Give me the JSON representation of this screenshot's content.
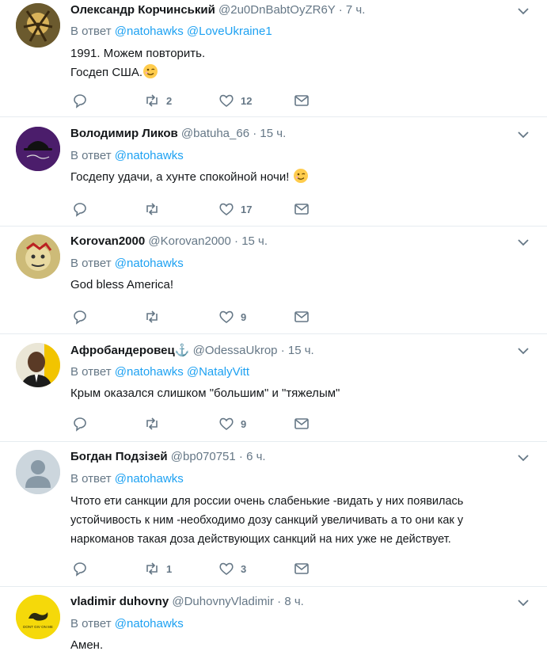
{
  "ui": {
    "reply_prefix": "В ответ",
    "accent": "#1da1f2",
    "muted": "#657786"
  },
  "tweets": [
    {
      "name": "Олександр Корчинський",
      "handle": "@2u0DnBabtOyZR6Y",
      "time": "7 ч.",
      "mentions": [
        "@natohawks",
        "@LoveUkraine1"
      ],
      "lines": [
        "1991. Можем повторить.",
        "Госдеп США."
      ],
      "emoji": "winking-face",
      "counts": {
        "retweets": "2",
        "likes": "12"
      }
    },
    {
      "name": "Володимир Ликов",
      "handle": "@batuha_66",
      "time": "15 ч.",
      "mentions": [
        "@natohawks"
      ],
      "lines": [
        "Госдепу удачи, а хунте спокойной ночи!"
      ],
      "emoji": "winking-face",
      "counts": {
        "retweets": "",
        "likes": "17"
      }
    },
    {
      "name": "Korovan2000",
      "handle": "@Korovan2000",
      "time": "15 ч.",
      "mentions": [
        "@natohawks"
      ],
      "lines": [
        "God bless America!"
      ],
      "counts": {
        "retweets": "",
        "likes": "9"
      }
    },
    {
      "name": "Афробандеровец",
      "name_emoji": "⚓",
      "handle": "@OdessaUkrop",
      "time": "15 ч.",
      "mentions": [
        "@natohawks",
        "@NatalyVitt"
      ],
      "lines": [
        "Крым оказался слишком \"большим\" и \"тяжелым\""
      ],
      "counts": {
        "retweets": "",
        "likes": "9"
      }
    },
    {
      "name": "Богдан Подзізей",
      "handle": "@bp070751",
      "time": "6 ч.",
      "mentions": [
        "@natohawks"
      ],
      "lines": [
        "Чтото ети санкции для россии очень слабенькие -видать у них появилась",
        "устойчивость к ним -необходимо дозу санкций увеличивать а то они как у",
        "наркоманов такая доза действующих санкций на них уже не действует."
      ],
      "counts": {
        "retweets": "1",
        "likes": "3"
      }
    },
    {
      "name": "vladimir duhovny",
      "handle": "@DuhovnyVladimir",
      "time": "8 ч.",
      "mentions": [
        "@natohawks"
      ],
      "lines": [
        "Амен."
      ],
      "avatar_text": "DONT GIV ON ME",
      "counts": {
        "retweets": "",
        "likes": ""
      }
    }
  ]
}
